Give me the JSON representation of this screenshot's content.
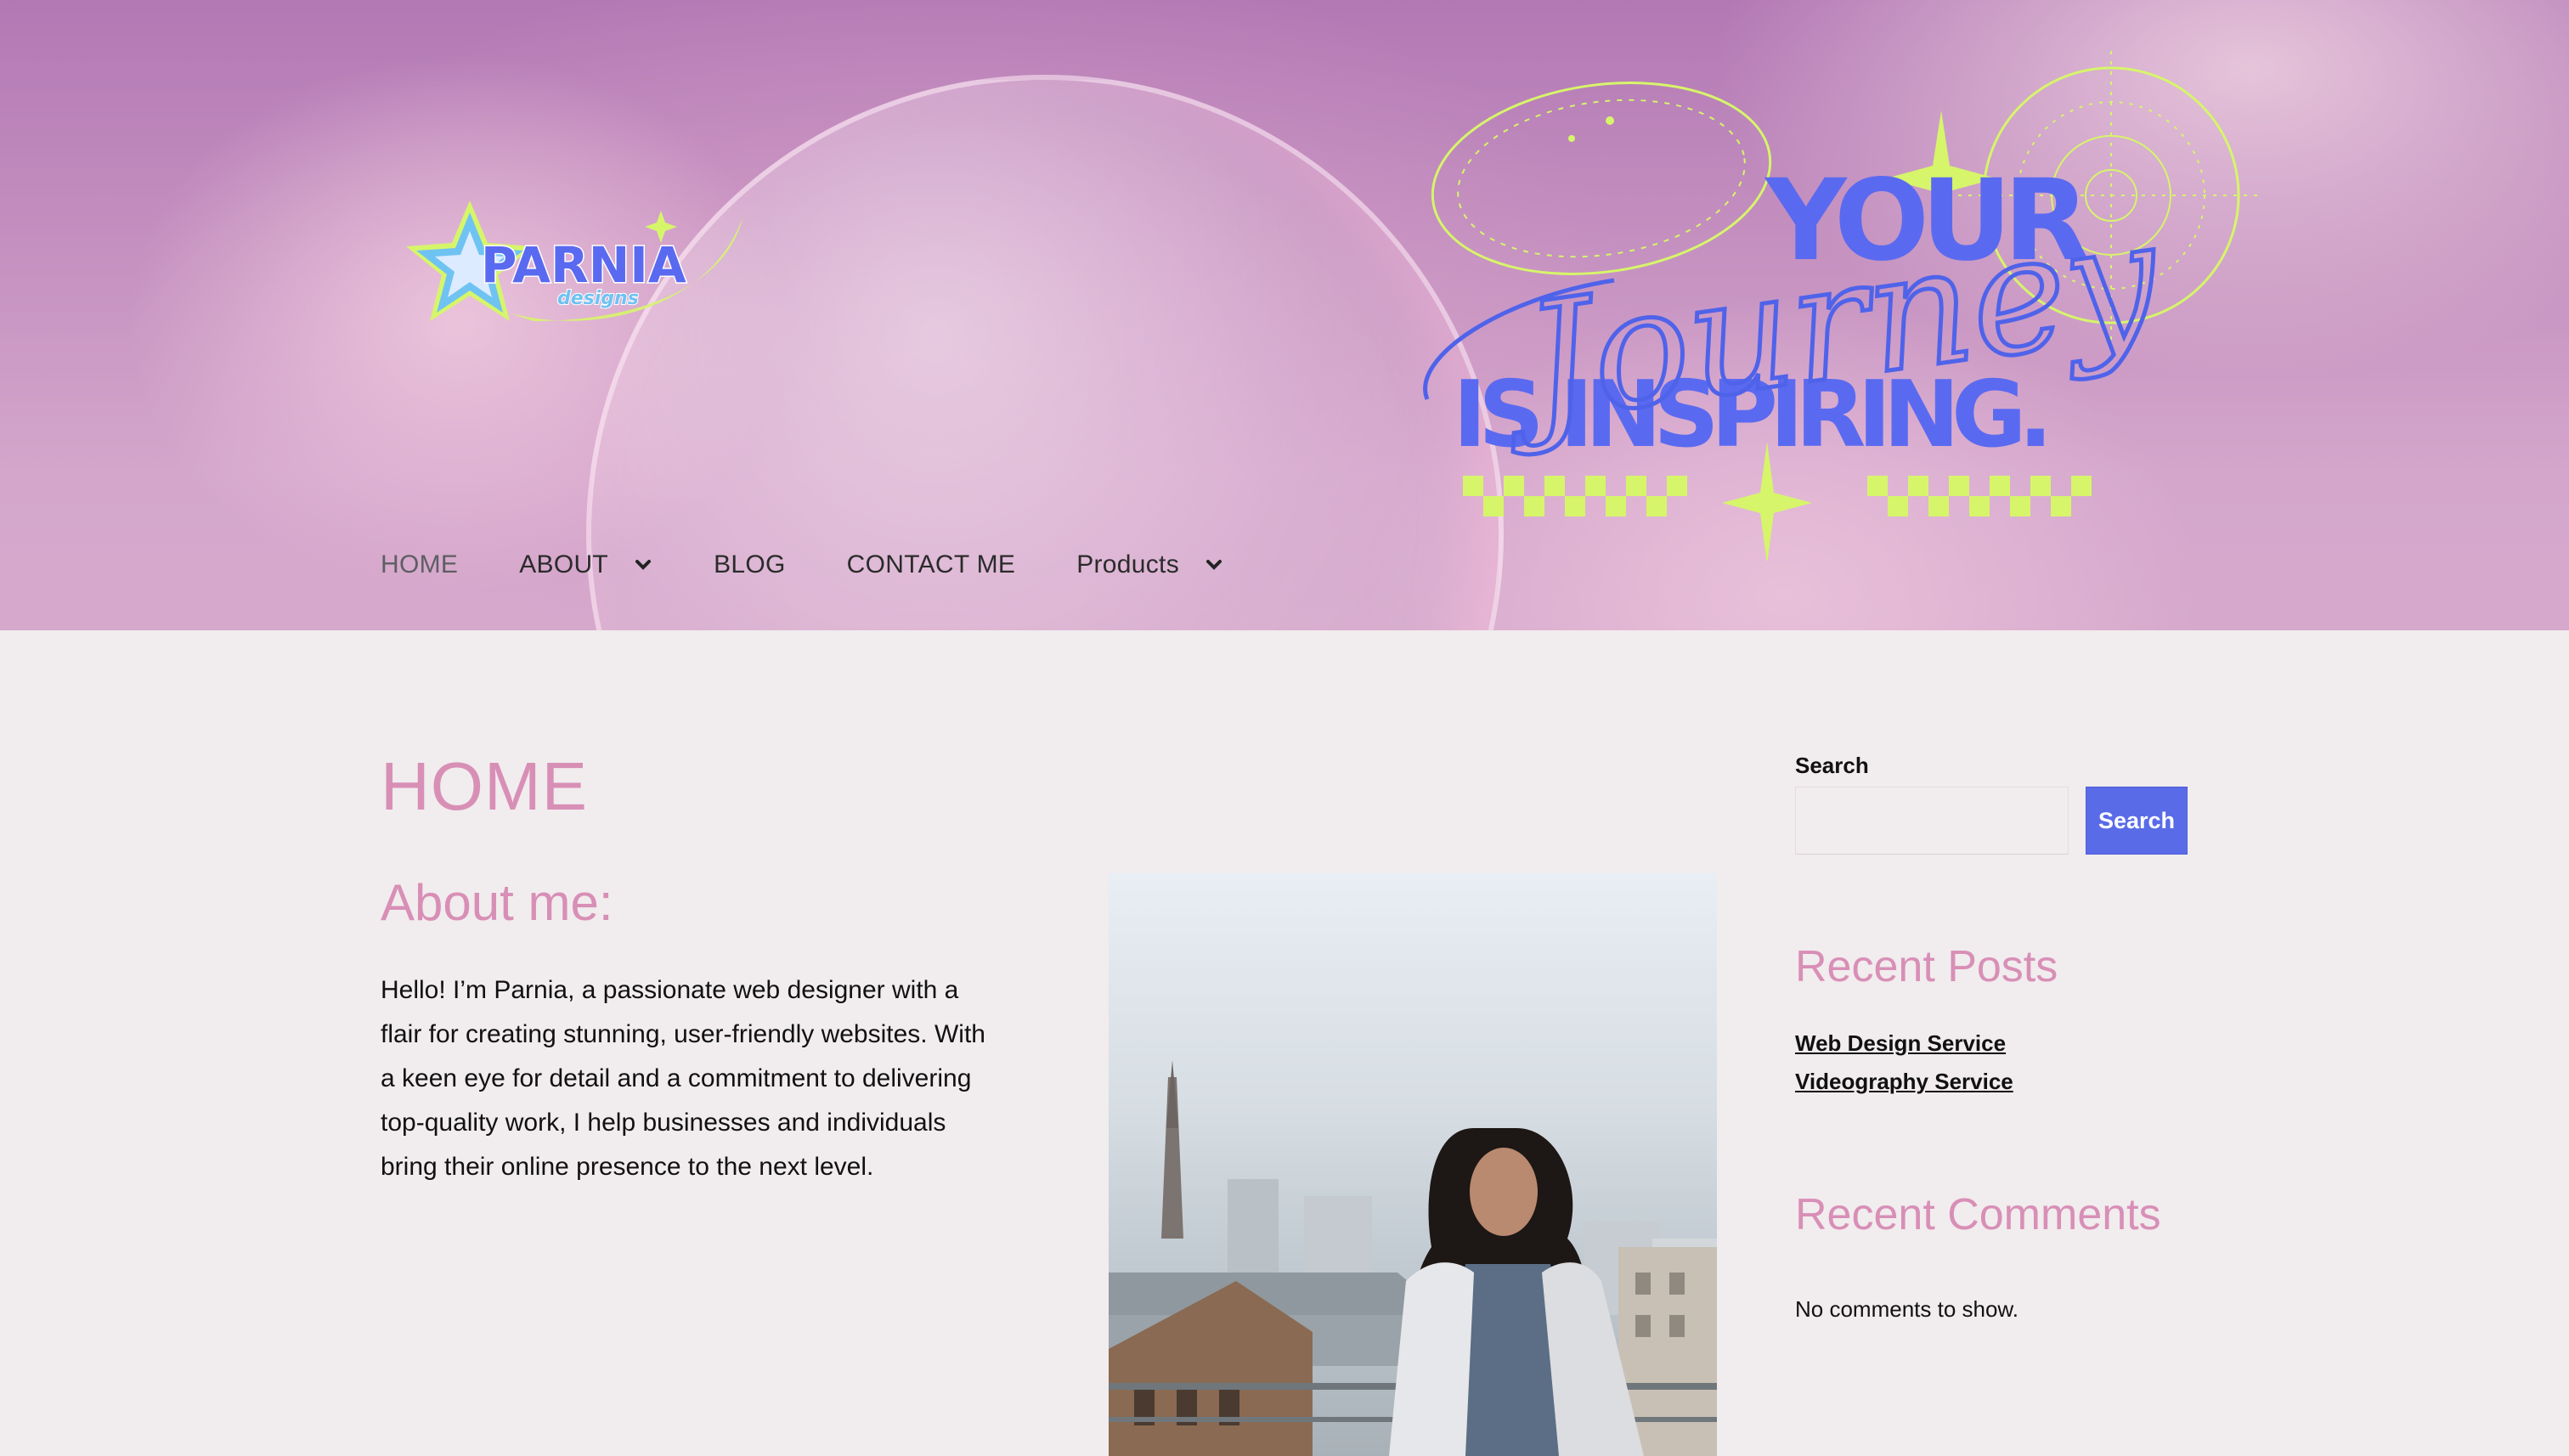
{
  "brand": {
    "logo_text": "PARNIA",
    "logo_subtext": "designs"
  },
  "hero": {
    "line1": "YOUR",
    "script": "Journey",
    "line2": "IS INSPIRING."
  },
  "nav": {
    "items": [
      {
        "label": "HOME",
        "has_dropdown": false,
        "active": true
      },
      {
        "label": "ABOUT",
        "has_dropdown": true
      },
      {
        "label": "BLOG",
        "has_dropdown": false
      },
      {
        "label": "CONTACT ME",
        "has_dropdown": false
      },
      {
        "label": "Products",
        "has_dropdown": true
      }
    ]
  },
  "main": {
    "title": "HOME",
    "about_heading": "About me:",
    "about_text": "Hello! I’m Parnia, a passionate web designer with a flair for creating stunning, user-friendly websites. With a keen eye for detail and a commitment to delivering top-quality work, I help businesses and individuals bring their online presence to the next level."
  },
  "sidebar": {
    "search_label": "Search",
    "search_placeholder": "",
    "search_button": "Search",
    "recent_posts_heading": "Recent Posts",
    "recent_posts": [
      "Web Design Service",
      "Videography Service"
    ],
    "recent_comments_heading": "Recent Comments",
    "no_comments": "No comments to show."
  },
  "colors": {
    "accent_pink": "#d88fb6",
    "button_blue": "#5a6be8",
    "page_bg": "#f1ecee",
    "hero_blue": "#5a6af0",
    "hero_lime": "#d6f56a"
  },
  "icons": [
    "chevron-down-icon",
    "star-logo-icon",
    "sparkle-icon"
  ]
}
